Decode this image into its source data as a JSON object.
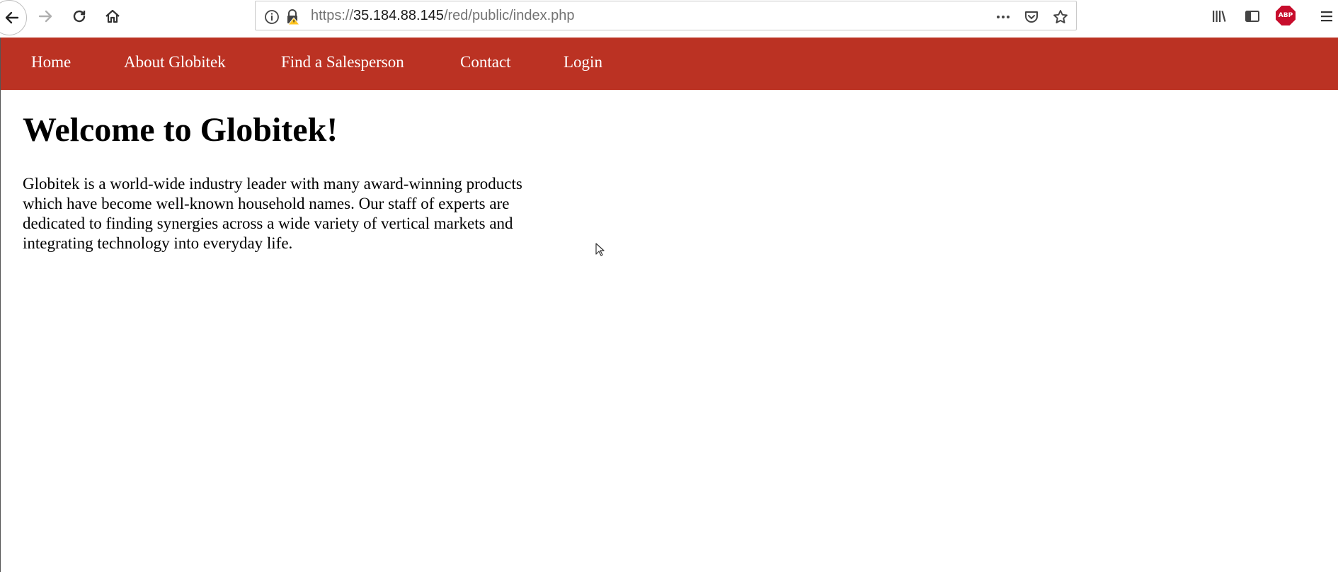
{
  "browser": {
    "url": {
      "scheme": "https://",
      "host": "35.184.88.145",
      "path": "/red/public/index.php"
    },
    "toolbar_icons": [
      "back-icon",
      "forward-icon",
      "reload-icon",
      "home-icon",
      "info-icon",
      "insecure-lock-icon",
      "more-icon",
      "pocket-icon",
      "bookmark-star-icon",
      "library-icon",
      "sidebar-icon",
      "adblock-icon",
      "menu-icon"
    ],
    "adblock_label": "ABP"
  },
  "nav": {
    "items": [
      {
        "label": "Home"
      },
      {
        "label": "About Globitek"
      },
      {
        "label": "Find a Salesperson"
      },
      {
        "label": "Contact"
      },
      {
        "label": "Login"
      }
    ],
    "background": "#bb3223"
  },
  "main": {
    "title": "Welcome to Globitek!",
    "body": "Globitek is a world-wide industry leader with many award-winning products which have become well-known household names. Our staff of experts are dedicated to finding synergies across a wide variety of vertical markets and integrating technology into everyday life."
  }
}
